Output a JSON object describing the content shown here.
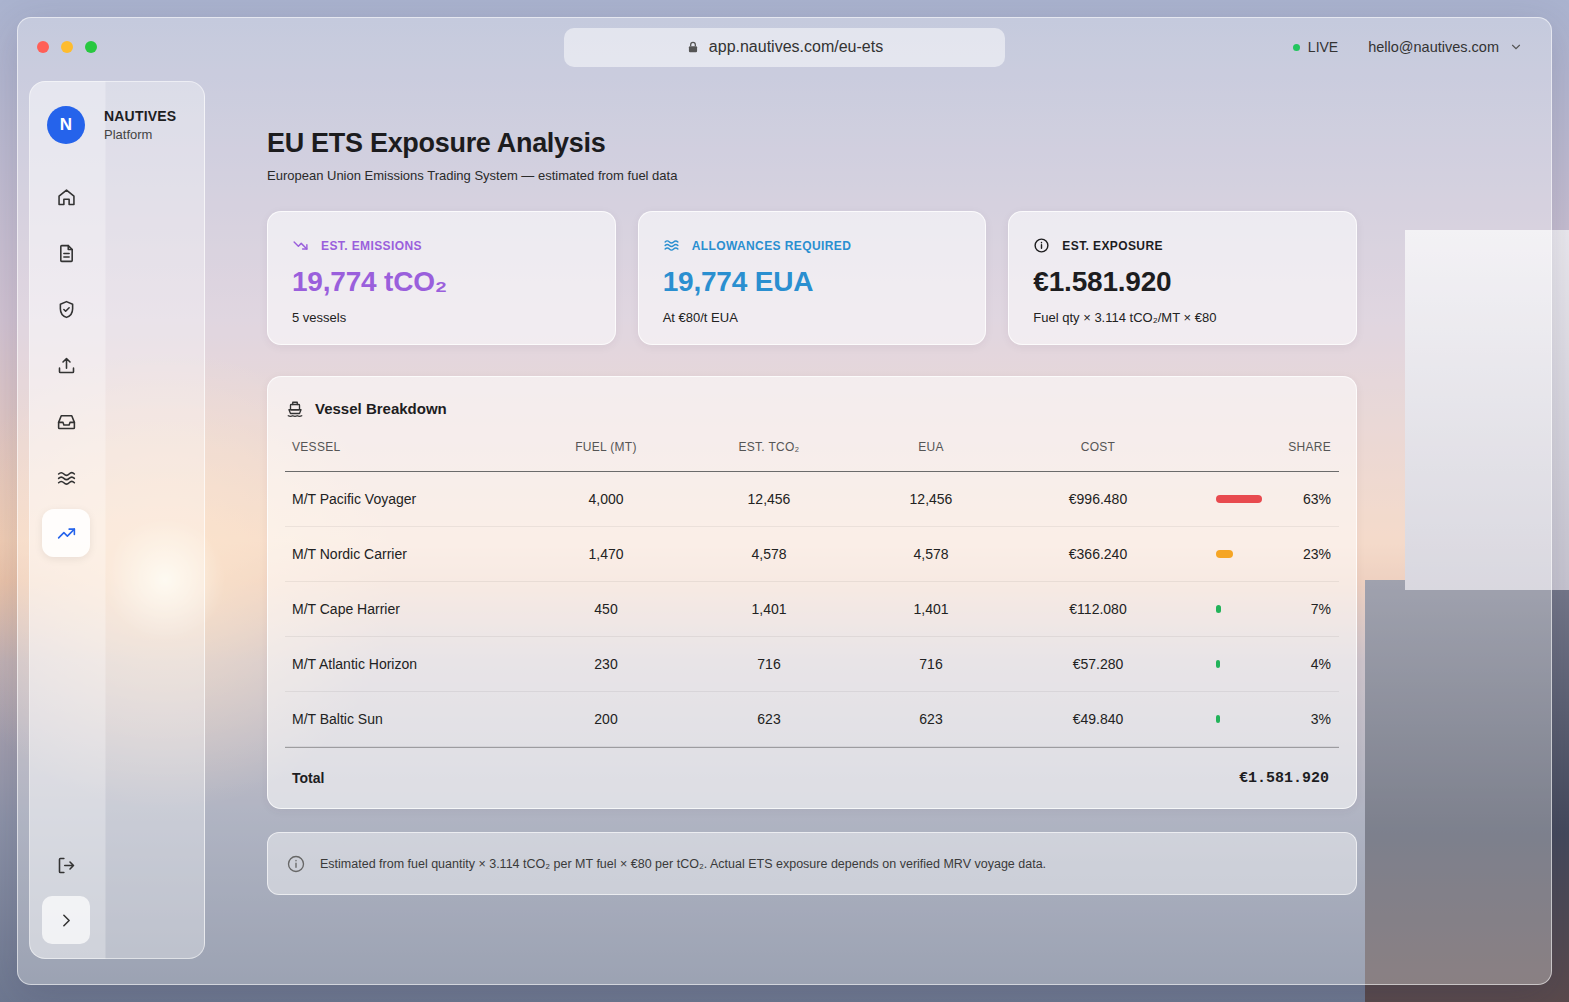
{
  "window": {
    "url": "app.nautives.com/eu-ets",
    "status": "LIVE",
    "live": true,
    "user": "hello@nautives.com"
  },
  "sidebar": {
    "logo_letter": "N",
    "brand": "NAUTIVES",
    "subtitle": "Platform",
    "items": [
      {
        "kind": "home",
        "selected": false
      },
      {
        "kind": "document",
        "selected": false
      },
      {
        "kind": "shield",
        "selected": false
      },
      {
        "kind": "upload",
        "selected": false
      },
      {
        "kind": "inbox",
        "selected": false
      },
      {
        "kind": "waves",
        "selected": false
      },
      {
        "kind": "chart",
        "selected": true
      }
    ],
    "footer_items": [
      {
        "kind": "logout"
      },
      {
        "kind": "expand"
      }
    ]
  },
  "page": {
    "title": "EU ETS Exposure Analysis",
    "subtitle": "European Union Emissions Trading System — estimated from fuel data"
  },
  "cards": [
    {
      "kind": "emissions",
      "label": "EST. EMISSIONS",
      "value": "19,774 tCO₂",
      "note": "5 vessels",
      "color": "#9a5fdc"
    },
    {
      "kind": "allowances",
      "label": "ALLOWANCES REQUIRED",
      "value": "19,774 EUA",
      "note": "At €80/t EUA",
      "color": "#2a8fd0"
    },
    {
      "kind": "exposure",
      "label": "EST. EXPOSURE",
      "value": "€1.581.920",
      "note": "Fuel qty × 3.114 tCO₂/MT × €80",
      "color": "#1d1d1f"
    }
  ],
  "table": {
    "title": "Vessel Breakdown",
    "columns": [
      "VESSEL",
      "FUEL (MT)",
      "EST. TCO₂",
      "EUA",
      "COST",
      "SHARE"
    ],
    "rows": [
      {
        "vessel": "M/T Pacific Voyager",
        "fuel": "4,000",
        "tco2": "12,456",
        "eua": "12,456",
        "cost": "€996.480",
        "share": "63%",
        "level": 0.63,
        "color": "#e84a4f"
      },
      {
        "vessel": "M/T Nordic Carrier",
        "fuel": "1,470",
        "tco2": "4,578",
        "eua": "4,578",
        "cost": "€366.240",
        "share": "23%",
        "level": 0.23,
        "color": "#f5a524"
      },
      {
        "vessel": "M/T Cape Harrier",
        "fuel": "450",
        "tco2": "1,401",
        "eua": "1,401",
        "cost": "€112.080",
        "share": "7%",
        "level": 0.07,
        "color": "#22b35a"
      },
      {
        "vessel": "M/T Atlantic Horizon",
        "fuel": "230",
        "tco2": "716",
        "eua": "716",
        "cost": "€57.280",
        "share": "4%",
        "level": 0.04,
        "color": "#22b35a"
      },
      {
        "vessel": "M/T Baltic Sun",
        "fuel": "200",
        "tco2": "623",
        "eua": "623",
        "cost": "€49.840",
        "share": "3%",
        "level": 0.03,
        "color": "#22b35a"
      }
    ],
    "total": {
      "label": "Total",
      "value": "€1.581.920"
    }
  },
  "footnote": "Estimated from fuel quantity × 3.114 tCO₂ per MT fuel × €80 per tCO₂. Actual ETS exposure depends on verified MRV voyage data."
}
